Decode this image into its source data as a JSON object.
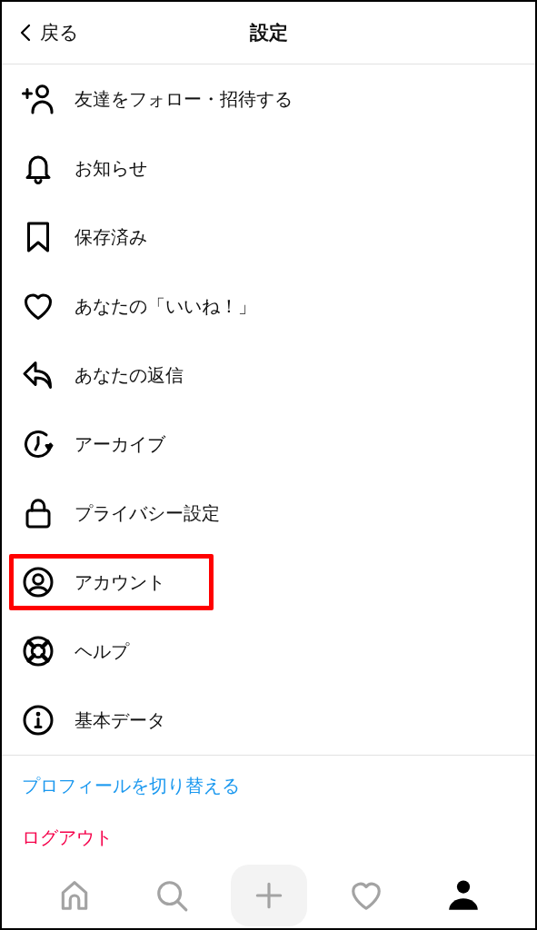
{
  "header": {
    "back": "戻る",
    "title": "設定"
  },
  "menu": [
    {
      "label": "友達をフォロー・招待する",
      "highlighted": false
    },
    {
      "label": "お知らせ",
      "highlighted": false
    },
    {
      "label": "保存済み",
      "highlighted": false
    },
    {
      "label": "あなたの「いいね！」",
      "highlighted": false
    },
    {
      "label": "あなたの返信",
      "highlighted": false
    },
    {
      "label": "アーカイブ",
      "highlighted": false
    },
    {
      "label": "プライバシー設定",
      "highlighted": false
    },
    {
      "label": "アカウント",
      "highlighted": true
    },
    {
      "label": "ヘルプ",
      "highlighted": false
    },
    {
      "label": "基本データ",
      "highlighted": false
    }
  ],
  "switch_profile": "プロフィールを切り替える",
  "logout": "ログアウト",
  "tab_bar": [
    {
      "selected": false
    },
    {
      "selected": false
    },
    {
      "selected": false
    },
    {
      "selected": false
    },
    {
      "selected": true
    }
  ]
}
